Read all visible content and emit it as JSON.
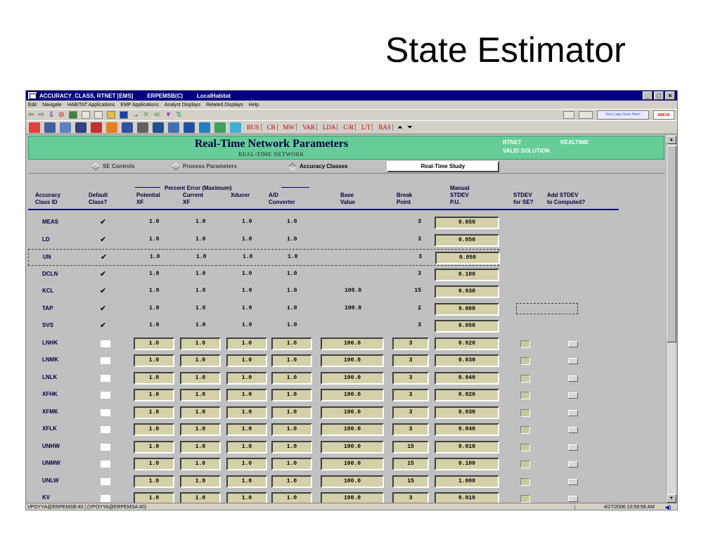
{
  "slide_title": "State Estimator",
  "window": {
    "title_parts": [
      "ACCURACY_CLASS, RTNET [EMS]",
      "ERPEMSB(C)",
      "LocalHabitat"
    ],
    "menu": [
      "Edit",
      "Navigate",
      "HABITAT Applications",
      "EMP Applications",
      "Analyst Displays",
      "Related Displays",
      "Help"
    ],
    "logo_text": "Your Logo Goes Here!",
    "areva_text": "AREVA",
    "toolbar_text_buttons": [
      "BUS",
      "CB",
      "MW",
      "VAR",
      "LDA",
      "C/R",
      "L/T",
      "BAS"
    ]
  },
  "header": {
    "title": "Real-Time Network Parameters",
    "subtitle": "REAL-TIME NETWORK",
    "rtnet": "RTNET",
    "realtime": "REALTIME",
    "valid": "VALID SOLUTION"
  },
  "tabs": {
    "se_controls": "SE Controls",
    "process_parameters": "Process Parameters",
    "accuracy_classes": "Accuracy Classes",
    "real_time_study": "Real-Time Study"
  },
  "columns": {
    "group_label": "Percent Error (Maximum)",
    "class_id": [
      "Accuracy",
      "Class ID"
    ],
    "default": [
      "Default",
      "Class?"
    ],
    "potential": [
      "Potential",
      "XF"
    ],
    "current": [
      "Current",
      "XF"
    ],
    "xducer": [
      "Xducer",
      ""
    ],
    "ad": [
      "A/D",
      "Converter"
    ],
    "base": [
      "Base",
      "Value"
    ],
    "break": [
      "Break",
      "Point"
    ],
    "manual": [
      "Manual",
      "STDEV",
      "P.U."
    ],
    "stdev_se": [
      "STDEV",
      "for SE?"
    ],
    "add_stdev": [
      "Add STDEV",
      "to Computed?"
    ]
  },
  "rows": [
    {
      "id": "MEAS",
      "def": true,
      "pot": "1.0",
      "cur": "1.0",
      "xd": "1.0",
      "ad": "1.0",
      "base": "",
      "brk": "3",
      "man": "0.050",
      "editable": false
    },
    {
      "id": "LD",
      "def": true,
      "pot": "1.0",
      "cur": "1.0",
      "xd": "1.0",
      "ad": "1.0",
      "base": "",
      "brk": "3",
      "man": "0.050",
      "editable": false
    },
    {
      "id": "UN",
      "def": true,
      "pot": "1.0",
      "cur": "1.0",
      "xd": "1.0",
      "ad": "1.0",
      "base": "",
      "brk": "3",
      "man": "0.050",
      "editable": false,
      "selected": true
    },
    {
      "id": "DCLN",
      "def": true,
      "pot": "1.0",
      "cur": "1.0",
      "xd": "1.0",
      "ad": "1.0",
      "base": "",
      "brk": "3",
      "man": "0.100",
      "editable": false
    },
    {
      "id": "KCL",
      "def": true,
      "pot": "1.0",
      "cur": "1.0",
      "xd": "1.0",
      "ad": "1.0",
      "base": "100.0",
      "brk": "15",
      "man": "0.030",
      "editable": false
    },
    {
      "id": "TAP",
      "def": true,
      "pot": "1.0",
      "cur": "1.0",
      "xd": "1.0",
      "ad": "1.0",
      "base": "100.0",
      "brk": "2",
      "man": "9.000",
      "editable": false,
      "dash": true
    },
    {
      "id": "SVS",
      "def": true,
      "pot": "1.0",
      "cur": "1.0",
      "xd": "1.0",
      "ad": "1.0",
      "base": "",
      "brk": "3",
      "man": "0.050",
      "editable": false
    },
    {
      "id": "LNHK",
      "def": false,
      "pot": "1.0",
      "cur": "1.0",
      "xd": "1.0",
      "ad": "1.0",
      "base": "100.0",
      "brk": "3",
      "man": "0.020",
      "editable": true
    },
    {
      "id": "LNMK",
      "def": false,
      "pot": "1.0",
      "cur": "1.0",
      "xd": "1.0",
      "ad": "1.0",
      "base": "100.0",
      "brk": "3",
      "man": "0.030",
      "editable": true
    },
    {
      "id": "LNLK",
      "def": false,
      "pot": "1.0",
      "cur": "1.0",
      "xd": "1.0",
      "ad": "1.0",
      "base": "100.0",
      "brk": "3",
      "man": "0.040",
      "editable": true
    },
    {
      "id": "XFHK",
      "def": false,
      "pot": "1.0",
      "cur": "1.0",
      "xd": "1.0",
      "ad": "1.0",
      "base": "100.0",
      "brk": "3",
      "man": "0.020",
      "editable": true
    },
    {
      "id": "XFMK",
      "def": false,
      "pot": "1.0",
      "cur": "1.0",
      "xd": "1.0",
      "ad": "1.0",
      "base": "100.0",
      "brk": "3",
      "man": "0.030",
      "editable": true
    },
    {
      "id": "XFLK",
      "def": false,
      "pot": "1.0",
      "cur": "1.0",
      "xd": "1.0",
      "ad": "1.0",
      "base": "100.0",
      "brk": "3",
      "man": "0.040",
      "editable": true
    },
    {
      "id": "UNHW",
      "def": false,
      "pot": "1.0",
      "cur": "1.0",
      "xd": "1.0",
      "ad": "1.0",
      "base": "100.0",
      "brk": "15",
      "man": "0.010",
      "editable": true
    },
    {
      "id": "UNMW",
      "def": false,
      "pot": "1.0",
      "cur": "1.0",
      "xd": "1.0",
      "ad": "1.0",
      "base": "100.0",
      "brk": "15",
      "man": "0.100",
      "editable": true
    },
    {
      "id": "UNLW",
      "def": false,
      "pot": "1.0",
      "cur": "1.0",
      "xd": "1.0",
      "ad": "1.0",
      "base": "100.0",
      "brk": "15",
      "man": "1.000",
      "editable": true
    },
    {
      "id": "KV",
      "def": false,
      "pot": "1.0",
      "cur": "1.0",
      "xd": "1.0",
      "ad": "1.0",
      "base": "100.0",
      "brk": "3",
      "man": "0.010",
      "editable": true
    }
  ],
  "status": {
    "left": "VPOYYA@ERPEMSB:40 | (VPOYYA@ERPEMSA:40)",
    "right": "4/27/2006 10:59:58 AM"
  }
}
